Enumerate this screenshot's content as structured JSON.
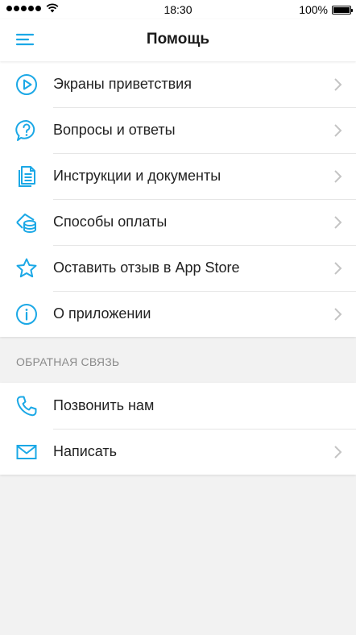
{
  "status_bar": {
    "time": "18:30",
    "battery": "100%",
    "battery_level": 1.0
  },
  "nav": {
    "title": "Помощь"
  },
  "accent_color": "#1ba8e6",
  "help_items": [
    {
      "label": "Экраны приветствия",
      "icon": "play-circle-icon",
      "has_chevron": true
    },
    {
      "label": "Вопросы и ответы",
      "icon": "question-bubble-icon",
      "has_chevron": true
    },
    {
      "label": "Инструкции и документы",
      "icon": "documents-icon",
      "has_chevron": true
    },
    {
      "label": "Способы оплаты",
      "icon": "coins-icon",
      "has_chevron": true
    },
    {
      "label": "Оставить отзыв в App Store",
      "icon": "star-icon",
      "has_chevron": true
    },
    {
      "label": "О приложении",
      "icon": "info-circle-icon",
      "has_chevron": true
    }
  ],
  "feedback": {
    "header": "ОБРАТНАЯ СВЯЗЬ",
    "items": [
      {
        "label": "Позвонить нам",
        "icon": "phone-icon",
        "has_chevron": false
      },
      {
        "label": "Написать",
        "icon": "envelope-icon",
        "has_chevron": true
      }
    ]
  }
}
